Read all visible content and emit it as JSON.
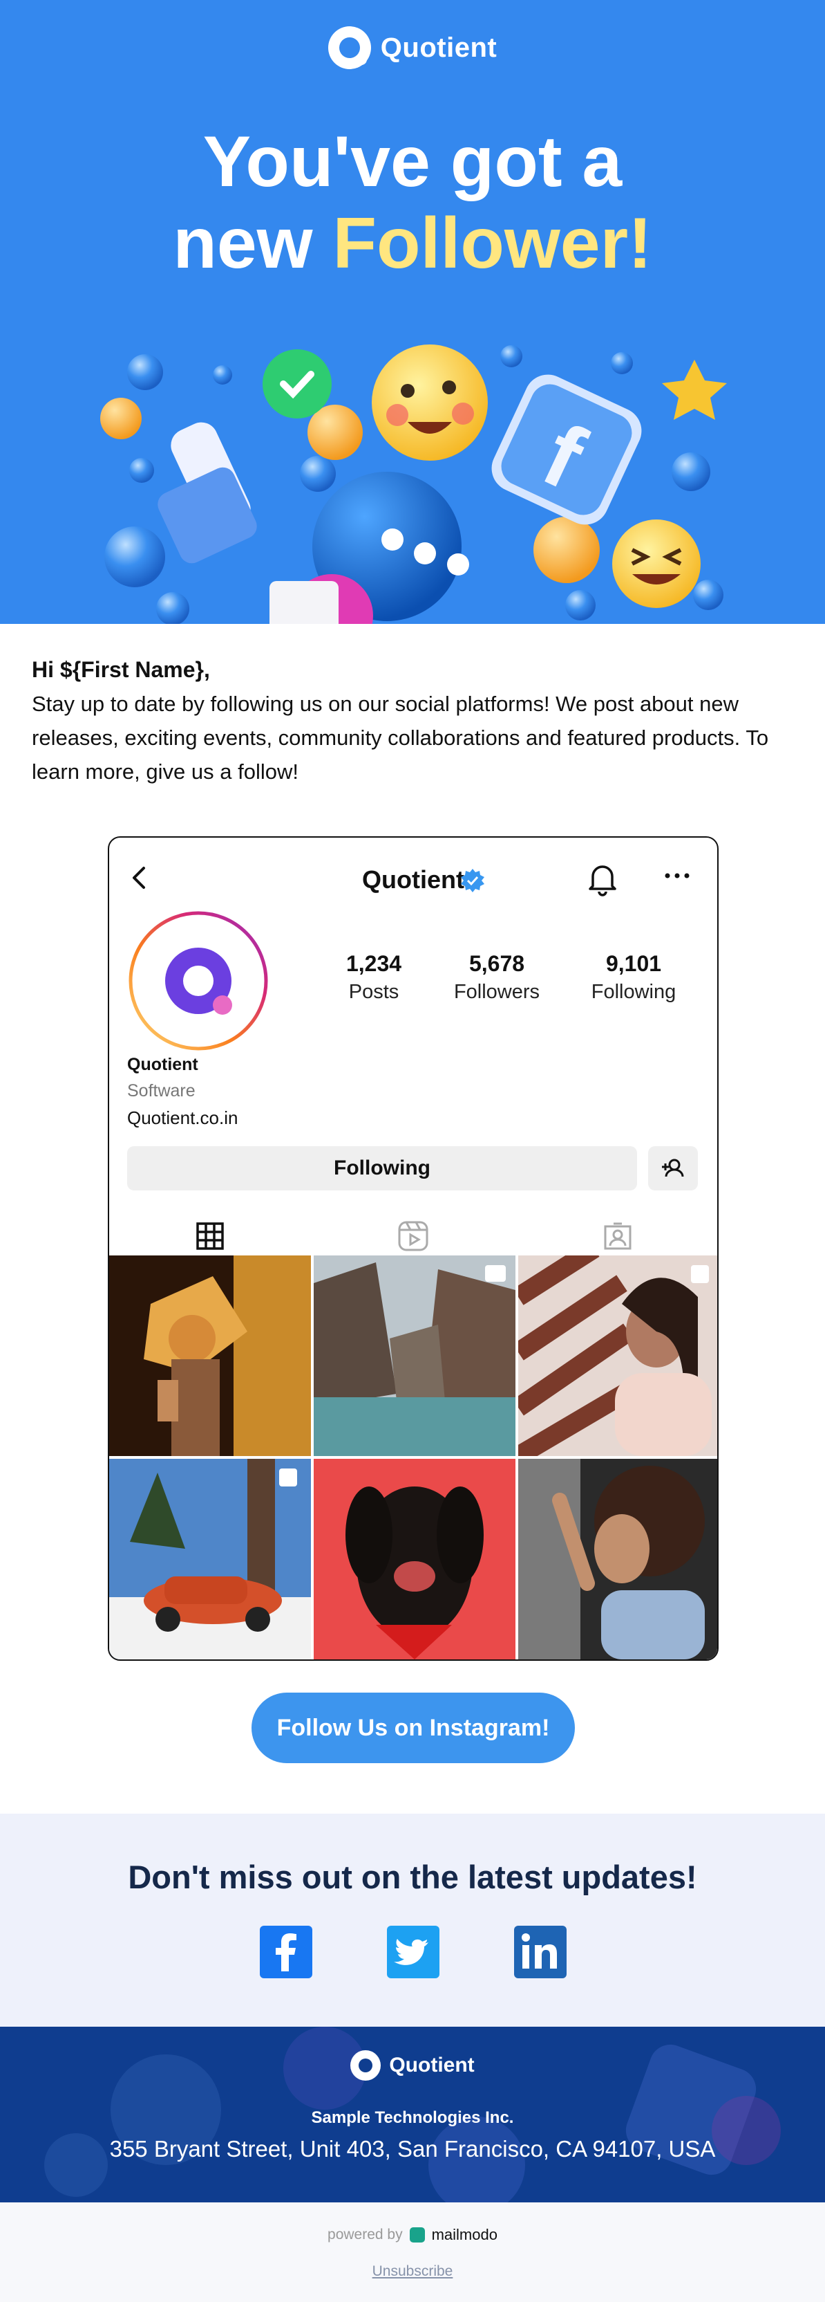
{
  "colors": {
    "hero_bg": "#3488ee",
    "highlight": "#ffe680",
    "cta_bg": "#3d95ee",
    "updates_bg": "#eef1fb",
    "footer_bg": "#0f3d8f",
    "facebook": "#1877f2",
    "twitter": "#1da1f2",
    "linkedin": "#1e64b4"
  },
  "hero": {
    "brand_name": "Quotient",
    "headline_line1": "You've got a",
    "headline_line2_prefix": "new ",
    "headline_line2_highlight": "Follower!"
  },
  "intro": {
    "greeting": "Hi ${First Name},",
    "body": "Stay up to date by following us on our social platforms! We post about new releases, exciting events, community collaborations and featured products. To learn more, give us a follow!"
  },
  "profile": {
    "title": "Quotient",
    "stats": [
      {
        "value": "1,234",
        "label": "Posts"
      },
      {
        "value": "5,678",
        "label": "Followers"
      },
      {
        "value": "9,101",
        "label": "Following"
      }
    ],
    "name": "Quotient",
    "category": "Software",
    "website": "Quotient.co.in",
    "following_button": "Following",
    "icons": [
      "back-arrow-icon",
      "verified-badge-icon",
      "bell-icon",
      "more-icon",
      "add-user-icon",
      "grid-icon",
      "reels-icon",
      "tagged-icon"
    ]
  },
  "cta_label": "Follow Us on Instagram!",
  "updates": {
    "title": "Don't miss out on the latest updates!",
    "socials": [
      "facebook-icon",
      "twitter-icon",
      "linkedin-icon"
    ]
  },
  "footer": {
    "brand_name": "Quotient",
    "company": "Sample Technologies Inc.",
    "address": "355 Bryant Street, Unit 403, San Francisco, CA 94107, USA"
  },
  "bottom": {
    "powered_by": "powered by",
    "powered_brand": "mailmodo",
    "unsubscribe": "Unsubscribe"
  }
}
